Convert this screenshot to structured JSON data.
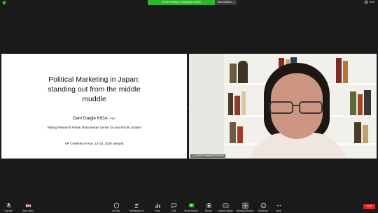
{
  "top_bar": {
    "share_banner": "You are viewing D.Yokoyama's screen",
    "view_options": "View Options ⌄",
    "view_label": "View"
  },
  "slide": {
    "title_line1": "Political Marketing in Japan:",
    "title_line2": "standing out from the middle",
    "title_line3": "muddle",
    "author": "Dani Daigle KIDA,",
    "author_degree": "PhD",
    "affiliation": "Visiting Research Fellow, Ritsumeikan Center for Asia Pacific Studies",
    "conference": "AP Conference Nov. 14-15, 2020 (virtual)"
  },
  "video": {
    "participant_name": "(Chair, Presenter) Dani KIDA"
  },
  "toolbar": {
    "unmute": "Unmute",
    "start_video": "Start Video",
    "security": "Security",
    "participants": "Participants",
    "participants_count": "42",
    "polls": "Polls",
    "chat": "Chat",
    "share_screen": "Share Screen",
    "record": "Record",
    "closed_caption": "Closed Caption",
    "breakout_rooms": "Breakout Rooms",
    "reactions": "Reactions",
    "more": "More",
    "end": "End"
  },
  "colors": {
    "share_green": "#2db52d",
    "end_red": "#e02828",
    "background": "#1a1a1a"
  }
}
